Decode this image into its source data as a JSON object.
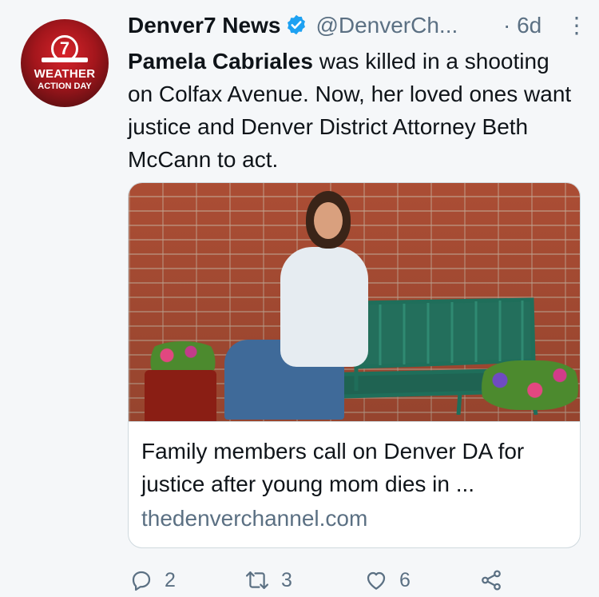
{
  "tweet": {
    "author": {
      "name": "Denver7 News",
      "handle": "@DenverCh...",
      "avatar_text_line1": "WEATHER",
      "avatar_text_line2": "ACTION DAY",
      "avatar_badge": "7"
    },
    "time": "6d",
    "more_glyph": "⋮",
    "text_bold": "Pamela Cabriales",
    "text_rest": " was killed in a shooting on Colfax Avenue. Now, her loved ones want justice and Denver District Attorney Beth McCann to act."
  },
  "card": {
    "title": "Family members call on Denver DA for justice after young mom dies in ...",
    "domain": "thedenverchannel.com"
  },
  "actions": {
    "replies": "2",
    "retweets": "3",
    "likes": "6"
  },
  "colors": {
    "text_primary": "#0f1419",
    "text_secondary": "#5b7083",
    "verified": "#1da1f2",
    "border": "#cfd9de",
    "background": "#f5f7f9"
  },
  "icons": [
    "verified-badge-icon",
    "more-icon",
    "reply-icon",
    "retweet-icon",
    "like-icon",
    "share-icon"
  ]
}
